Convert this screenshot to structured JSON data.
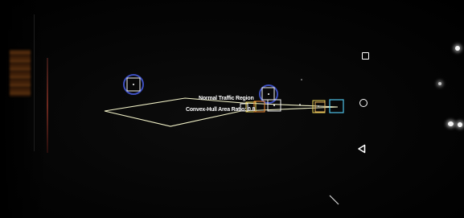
{
  "overlay": {
    "region_label": "Normal Traffic Region",
    "ratio_label": "Convex-Hull Area Ratio: 0.8",
    "colors": {
      "hull": "#f2f2c8",
      "highlight_circle": "#3d4fc0",
      "box_white": "#f2f2f2",
      "box_yellow": "#f0d85a",
      "box_orange": "#f08a32",
      "box_tan": "#e6b25a",
      "box_cyan": "#4fc2e8"
    }
  },
  "navigation": {
    "recents_icon": "square-icon",
    "home_icon": "circle-icon",
    "back_icon": "triangle-back-icon"
  }
}
